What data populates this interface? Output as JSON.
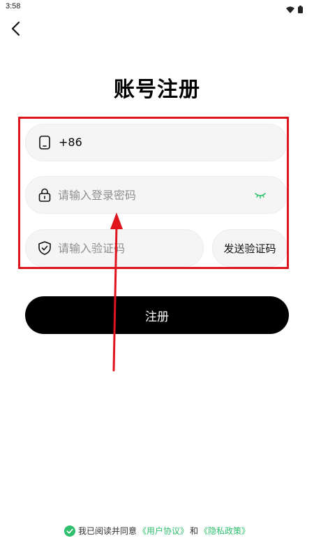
{
  "status_bar": {
    "time": "3:58",
    "icons": [
      "wifi-icon",
      "battery-icon"
    ]
  },
  "header": {
    "back_icon": "chevron-left-icon"
  },
  "page": {
    "title": "账号注册"
  },
  "form": {
    "phone": {
      "icon": "phone-icon",
      "prefix": "+86"
    },
    "password": {
      "icon": "lock-icon",
      "placeholder": "请输入登录密码",
      "toggle_icon": "eye-closed-icon"
    },
    "code": {
      "icon": "shield-icon",
      "placeholder": "请输入验证码"
    },
    "send_code_label": "发送验证码",
    "submit_label": "注册"
  },
  "agreement": {
    "check_icon": "check-circle-icon",
    "prefix": "我已阅读并同意",
    "user_agreement": "《用户协议》",
    "conjunction": "和",
    "privacy_policy": "《隐私政策》"
  },
  "colors": {
    "accent": "#2fbf6e",
    "annotation": "#e0141c",
    "button": "#000000",
    "field_bg": "#f5f5f5"
  }
}
